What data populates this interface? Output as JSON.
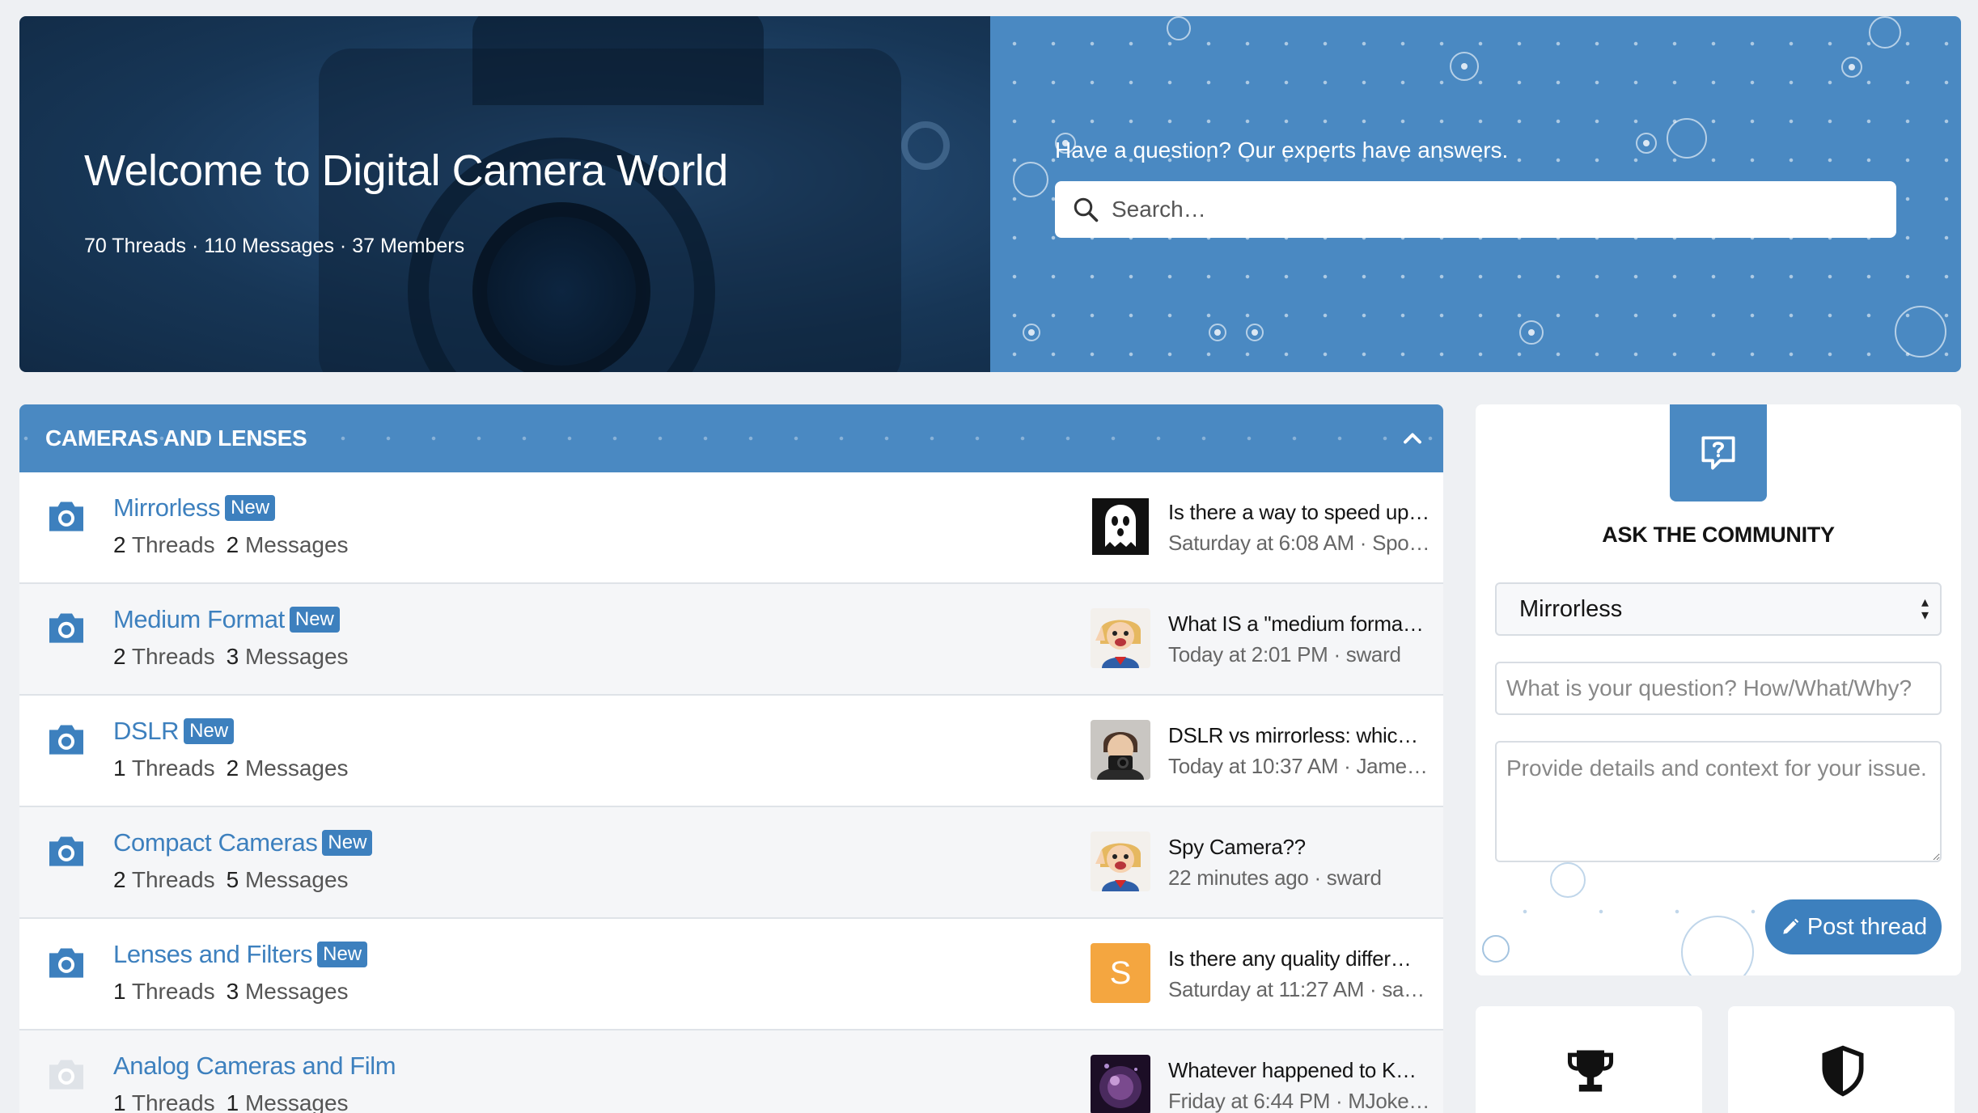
{
  "hero": {
    "title": "Welcome to Digital Camera World",
    "stats": "70 Threads · 110 Messages · 37 Members",
    "ask_label": "Have a question? Our experts have answers.",
    "search_placeholder": "Search…"
  },
  "forum_block": {
    "title": "CAMERAS AND LENSES",
    "nodes": [
      {
        "title": "Mirrorless",
        "badge": "New",
        "threads": "2",
        "threads_label": "Threads",
        "messages": "2",
        "messages_label": "Messages",
        "latest_title": "Is there a way to speed up…",
        "latest_meta": "Saturday at 6:08 AM · Spo…",
        "avatar": "ghost-avatar"
      },
      {
        "title": "Medium Format",
        "badge": "New",
        "threads": "2",
        "threads_label": "Threads",
        "messages": "3",
        "messages_label": "Messages",
        "latest_title": "What IS a \"medium forma…",
        "latest_meta": "Today at 2:01 PM · sward",
        "avatar": "cartoon-hero-avatar"
      },
      {
        "title": "DSLR",
        "badge": "New",
        "threads": "1",
        "threads_label": "Threads",
        "messages": "2",
        "messages_label": "Messages",
        "latest_title": "DSLR vs mirrorless: whic…",
        "latest_meta": "Today at 10:37 AM · Jame…",
        "avatar": "photographer-avatar"
      },
      {
        "title": "Compact Cameras",
        "badge": "New",
        "threads": "2",
        "threads_label": "Threads",
        "messages": "5",
        "messages_label": "Messages",
        "latest_title": "Spy Camera??",
        "latest_meta": "22 minutes ago · sward",
        "avatar": "cartoon-hero-avatar"
      },
      {
        "title": "Lenses and Filters",
        "badge": "New",
        "threads": "1",
        "threads_label": "Threads",
        "messages": "3",
        "messages_label": "Messages",
        "latest_title": "Is there any quality differ…",
        "latest_meta": "Saturday at 11:27 AM · sa…",
        "avatar": "letter-avatar",
        "avatar_letter": "S"
      },
      {
        "title": "Analog Cameras and Film",
        "badge": "",
        "threads": "1",
        "threads_label": "Threads",
        "messages": "1",
        "messages_label": "Messages",
        "latest_title": "Whatever happened to K…",
        "latest_meta": "Friday at 6:44 PM · MJoke…",
        "avatar": "purple-orb-avatar"
      }
    ]
  },
  "ask_community": {
    "heading": "ASK THE COMMUNITY",
    "selected_forum": "Mirrorless",
    "question_placeholder": "What is your question? How/What/Why?",
    "details_placeholder": "Provide details and context for your issue.",
    "post_button": "Post thread"
  },
  "colors": {
    "accent": "#3d80be",
    "header_blue": "#4a89c2",
    "hero_dark": "#173656",
    "avatar_orange": "#f4a640"
  },
  "icons": {
    "search": "search-icon",
    "forum_node": "camera-icon",
    "collapse": "chevron-up-icon",
    "ask": "question-bubble-icon",
    "post": "pencil-icon",
    "trophy": "trophy-icon",
    "shield": "shield-icon"
  }
}
